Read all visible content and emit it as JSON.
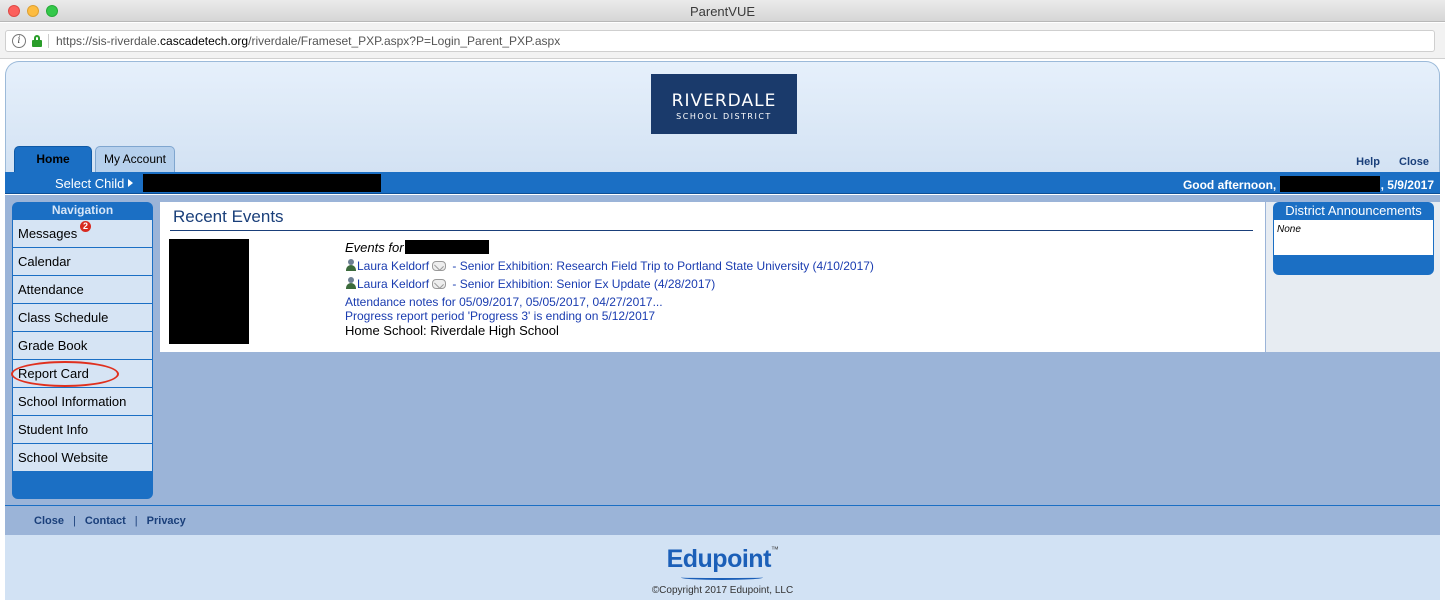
{
  "window": {
    "title": "ParentVUE",
    "url_prefix": "https://sis-riverdale.",
    "url_host": "cascadetech.org",
    "url_path": "/riverdale/Frameset_PXP.aspx?P=Login_Parent_PXP.aspx"
  },
  "header": {
    "logo_line1": "RIVERDALE",
    "logo_line2": "SCHOOL DISTRICT",
    "tabs": [
      {
        "label": "Home"
      },
      {
        "label": "My Account"
      }
    ],
    "help_label": "Help",
    "close_label": "Close"
  },
  "childbar": {
    "select_child_label": "Select Child",
    "greeting": "Good afternoon,",
    "date": ", 5/9/2017"
  },
  "navigation": {
    "title": "Navigation",
    "messages_badge": "2",
    "items": [
      {
        "label": "Messages"
      },
      {
        "label": "Calendar"
      },
      {
        "label": "Attendance"
      },
      {
        "label": "Class Schedule"
      },
      {
        "label": "Grade Book"
      },
      {
        "label": "Report Card"
      },
      {
        "label": "School Information"
      },
      {
        "label": "Student Info"
      },
      {
        "label": "School Website"
      }
    ]
  },
  "recent_events": {
    "title": "Recent Events",
    "events_for": "Events for",
    "events": [
      {
        "author": "Laura Keldorf",
        "text": " - Senior Exhibition: Research Field Trip to Portland State University (4/10/2017)"
      },
      {
        "author": "Laura Keldorf",
        "text": " - Senior Exhibition: Senior Ex Update (4/28/2017)"
      }
    ],
    "attendance_note": "Attendance notes for 05/09/2017, 05/05/2017, 04/27/2017...",
    "progress_note": "Progress report period 'Progress 3' is ending on 5/12/2017",
    "home_school": "Home School: Riverdale High School"
  },
  "announcements": {
    "title": "District Announcements",
    "body": "None"
  },
  "footer": {
    "links": [
      {
        "label": "Close"
      },
      {
        "label": "Contact"
      },
      {
        "label": "Privacy"
      }
    ],
    "brand": "Edupoint",
    "brand_tm": "™",
    "copyright": "©Copyright 2017 Edupoint, LLC"
  },
  "colors": {
    "primary_blue": "#1b6fc4",
    "content_bg": "#9bb4d8",
    "link": "#1a3cb0",
    "annotation_red": "#e0301e"
  }
}
